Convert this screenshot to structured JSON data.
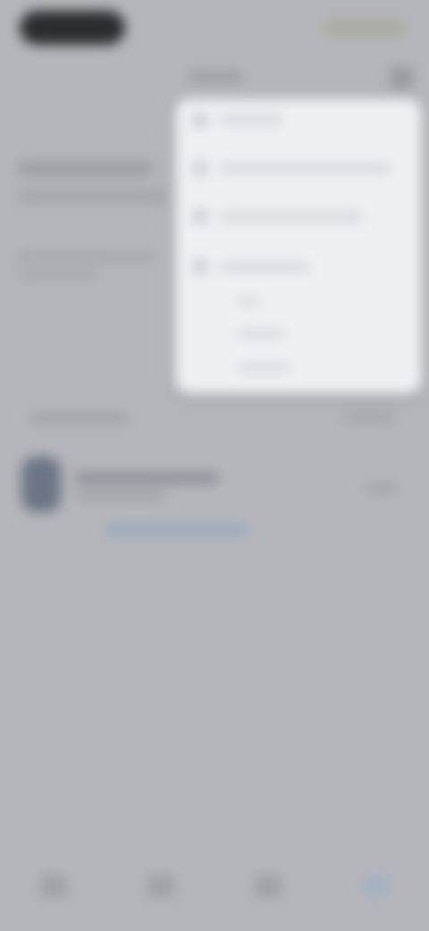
{
  "screen": {
    "title": "",
    "menu": {
      "items": [
        {
          "icon": "window-icon",
          "label": ""
        },
        {
          "icon": "window-icon",
          "label": ""
        },
        {
          "icon": "window-icon",
          "label": ""
        },
        {
          "icon": "window-icon",
          "label": ""
        }
      ],
      "submenu_items": [
        "",
        "",
        ""
      ]
    },
    "list": {
      "header_left": "",
      "header_right": "",
      "item": {
        "title": "",
        "subtitle": "",
        "meta": "",
        "progress": 0.35
      }
    },
    "bottom_nav": {
      "items": [
        {
          "icon": "home-icon"
        },
        {
          "icon": "search-icon"
        },
        {
          "icon": "bell-icon"
        },
        {
          "icon": "profile-icon",
          "active": true
        }
      ]
    },
    "colors": {
      "background": "#b5b6bb",
      "menu_background": "#eef0f3",
      "accent": "#8fa2bf"
    }
  }
}
